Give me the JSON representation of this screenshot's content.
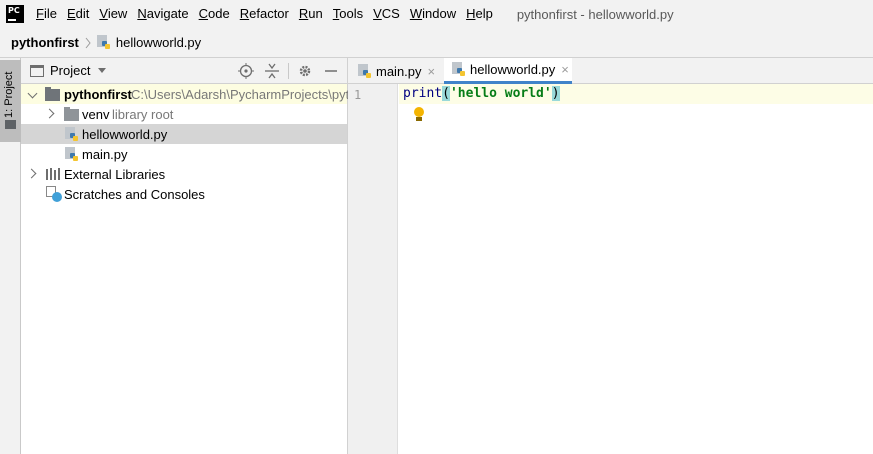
{
  "menubar": {
    "items": [
      {
        "label": "File",
        "mnemonic": "F",
        "rest": "ile"
      },
      {
        "label": "Edit",
        "mnemonic": "E",
        "rest": "dit"
      },
      {
        "label": "View",
        "mnemonic": "V",
        "rest": "iew"
      },
      {
        "label": "Navigate",
        "mnemonic": "N",
        "rest": "avigate"
      },
      {
        "label": "Code",
        "mnemonic": "C",
        "rest": "ode"
      },
      {
        "label": "Refactor",
        "mnemonic": "R",
        "rest": "efactor"
      },
      {
        "label": "Run",
        "mnemonic": "R",
        "rest": "un"
      },
      {
        "label": "Tools",
        "mnemonic": "T",
        "rest": "ools"
      },
      {
        "label": "VCS",
        "mnemonic": "V",
        "rest": "CS"
      },
      {
        "label": "Window",
        "mnemonic": "W",
        "rest": "indow"
      },
      {
        "label": "Help",
        "mnemonic": "H",
        "rest": "elp"
      }
    ],
    "window_title": "pythonfirst - hellowworld.py",
    "logo_text": "PC"
  },
  "navbar": {
    "project": "pythonfirst",
    "file": "hellowworld.py"
  },
  "toolstrip": {
    "project_tab_label": "1: Project"
  },
  "project_panel": {
    "title": "Project",
    "tree": {
      "root_name": "pythonfirst",
      "root_path": "C:\\Users\\Adarsh\\PycharmProjects\\pytho",
      "venv_name": "venv",
      "venv_note": "library root",
      "file1": "hellowworld.py",
      "file2": "main.py",
      "external_libraries": "External Libraries",
      "scratches": "Scratches and Consoles"
    }
  },
  "editor": {
    "tabs": [
      {
        "label": "main.py",
        "active": false
      },
      {
        "label": "hellowworld.py",
        "active": true
      }
    ],
    "close_glyph": "×",
    "line_number": "1",
    "code": {
      "fn": "print",
      "open_paren": "(",
      "string": "'hello world'",
      "close_paren": ")"
    }
  },
  "colors": {
    "accent": "#4083c9",
    "selection": "#d5d5d5",
    "current_line": "#fdfde6",
    "string": "#067d17",
    "keyword": "#000080"
  }
}
